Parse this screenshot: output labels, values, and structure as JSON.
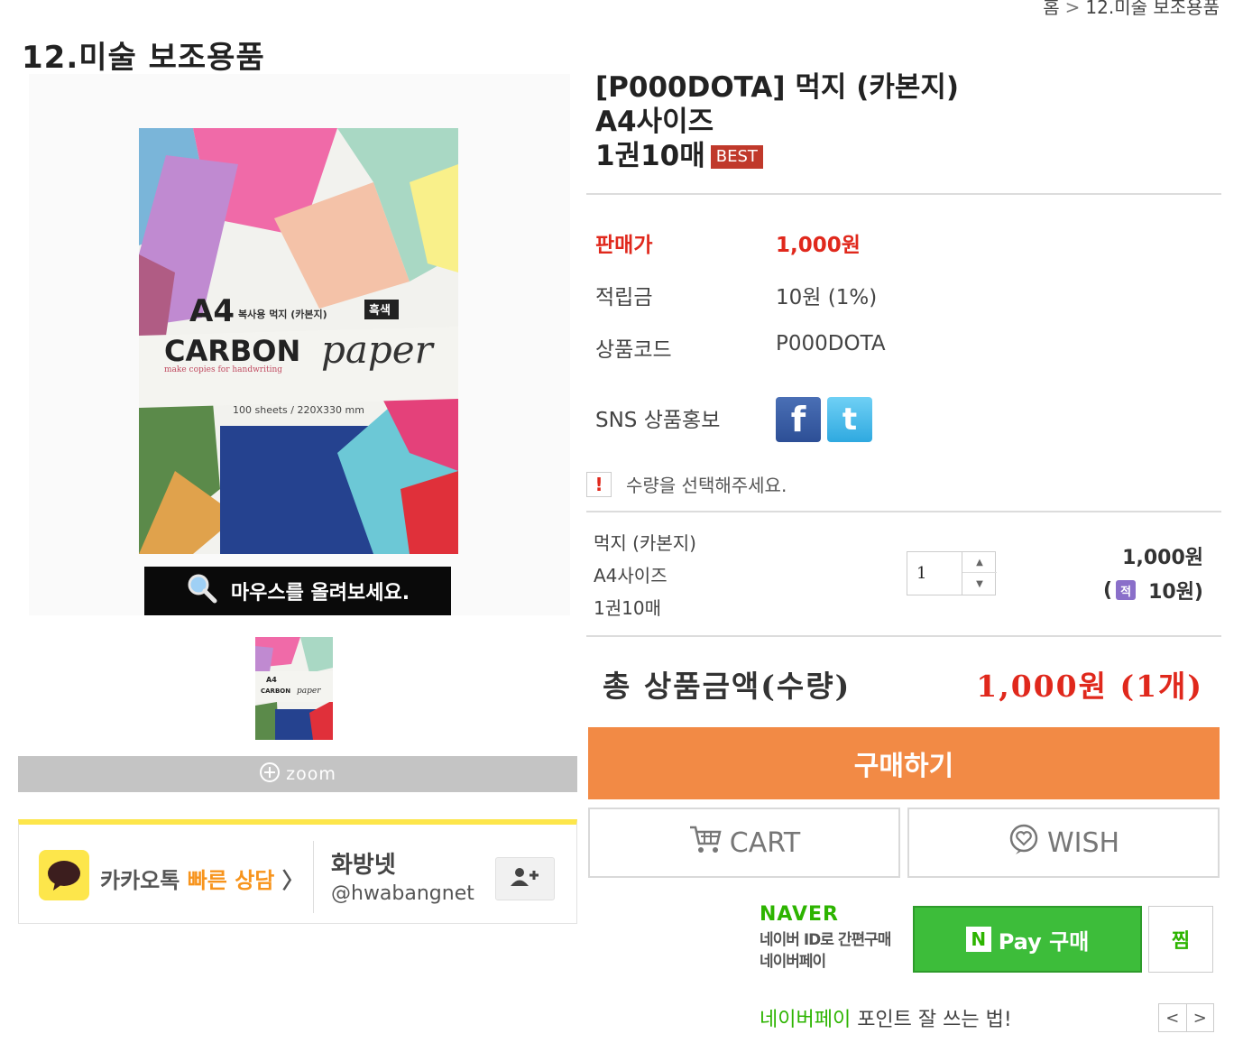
{
  "breadcrumb": {
    "home": "홈",
    "separator": ">",
    "current": "12.미술 보조용품"
  },
  "category_title": "12.미술 보조용품",
  "gallery": {
    "zoom_hint": "마우스를 올려보세요.",
    "zoom_label": "zoom",
    "product_image_text": {
      "a4": "A4",
      "subtitle": "복사용 먹지 (카본지)",
      "color_tag": "흑색",
      "carbon": "CARBON",
      "paper": "paper",
      "tagline": "make copies for handwriting",
      "sheets": "100 sheets / 220X330 mm"
    }
  },
  "kakao": {
    "label_prefix": "카카오톡 ",
    "label_fast": "빠른 상담",
    "label_arrow": " 〉",
    "name": "화방넷",
    "id": "@hwabangnet"
  },
  "product": {
    "name_line1": "[P000DOTA] 먹지 (카본지)",
    "name_line2": "A4사이즈",
    "name_line3": "1권10매",
    "badge": "BEST"
  },
  "info": {
    "price_label": "판매가",
    "price_value": "1,000원",
    "mileage_label": "적립금",
    "mileage_value": "10원 (1%)",
    "code_label": "상품코드",
    "code_value": "P000DOTA",
    "sns_label": "SNS 상품홍보"
  },
  "notice": {
    "icon": "!",
    "text": "수량을 선택해주세요."
  },
  "option": {
    "line1": "먹지 (카본지)",
    "line2": "A4사이즈",
    "line3": "1권10매",
    "quantity": "1",
    "price": "1,000원",
    "mileage_open": "(",
    "mileage_badge": "적",
    "mileage_value": "10원)"
  },
  "total": {
    "label": "총 상품금액(수량)",
    "value": "1,000원 (1개)"
  },
  "buttons": {
    "buy": "구매하기",
    "cart": "CART",
    "wish": "WISH"
  },
  "naver": {
    "logo": "NAVER",
    "desc_line1": "네이버 ID로 간편구매",
    "desc_line2": "네이버페이",
    "pay_n": "N",
    "pay_label": "Pay 구매",
    "zzim": "찜",
    "tip_green": "네이버페이",
    "tip_rest": " 포인트 잘 쓰는 법!",
    "prev": "<",
    "next": ">"
  },
  "colors": {
    "accent_red": "#e0281c",
    "buy_orange": "#f28a45",
    "naver_green": "#2db400",
    "kakao_yellow": "#fde64b",
    "best_badge": "#c0392b"
  }
}
